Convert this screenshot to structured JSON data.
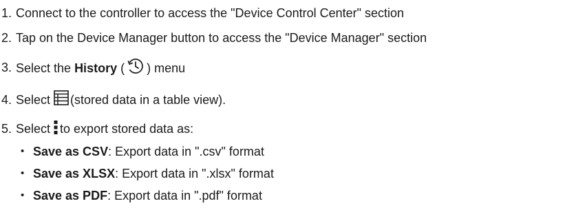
{
  "steps": [
    {
      "number": "1.",
      "text": "Connect to the controller to access the \"Device Control Center\" section"
    },
    {
      "number": "2.",
      "text": "Tap on the Device Manager button to access the \"Device Manager\" section"
    },
    {
      "number": "3.",
      "text_before": "Select the ",
      "bold": "History",
      "open_paren": " (",
      "icon": "history-icon",
      "close_text": ") menu"
    },
    {
      "number": "4.",
      "text_before": "Select ",
      "icon": "table-view-icon",
      "text_after": "(stored data in a table view)."
    },
    {
      "number": "5.",
      "text_before": "Select ",
      "icon": "more-vertical-icon",
      "text_after": "to export stored data as:"
    }
  ],
  "export_options": [
    {
      "bold": "Save as CSV",
      "text": ": Export data in \".csv\" format"
    },
    {
      "bold": "Save as XLSX",
      "text": ": Export data in \".xlsx\" format"
    },
    {
      "bold": "Save as PDF",
      "text": ": Export data in \".pdf\" format"
    }
  ],
  "bullet_char": "•",
  "colors": {
    "text": "#1a1a1a",
    "icon": "#1a1a1a"
  }
}
